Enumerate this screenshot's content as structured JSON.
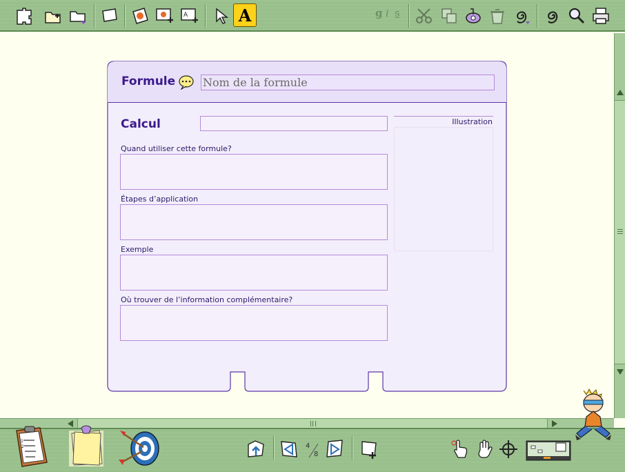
{
  "toolbar": {
    "text_tool_label": "A",
    "gis_chars": [
      "g",
      "i",
      "s"
    ]
  },
  "card": {
    "formula_label": "Formule",
    "formula_placeholder": "Nom de la formule",
    "calcul_label": "Calcul",
    "illustration_label": "Illustration",
    "fields": [
      "Quand utiliser cette formule?",
      "Étapes d’application",
      "Exemple",
      "Où trouver de l’information complémentaire?"
    ]
  },
  "bottom_bar": {
    "page_current": "4",
    "page_total": "8"
  },
  "colors": {
    "accent": "#3b1a8c",
    "card_border": "#5a36a8",
    "field_border": "#b48bd8",
    "toolbar_green": "#a6c99a",
    "workspace": "#fffff0",
    "text_tool_highlight": "#ffd21a"
  },
  "icons": {
    "top": [
      "puzzle-icon",
      "new-folder-icon",
      "folder-menu-icon",
      "blank-card-icon",
      "picture-card-icon",
      "add-picture-card-icon",
      "add-text-card-icon",
      "pointer-arrow-icon",
      "text-tool-icon",
      "gis-format-icon",
      "scissors-icon",
      "copy-icon",
      "tape-icon",
      "trash-icon",
      "spiral-menu-icon",
      "spiral-icon",
      "magnifier-icon",
      "printer-icon"
    ],
    "bottom": [
      "clipboard-checklist-icon",
      "sticky-notes-icon",
      "target-darts-icon",
      "stack-up-icon",
      "previous-card-icon",
      "next-card-icon",
      "add-card-icon",
      "pointing-hand-icon",
      "hand-icon",
      "crosshair-icon",
      "minimap-icon",
      "boy-mascot-icon"
    ]
  }
}
